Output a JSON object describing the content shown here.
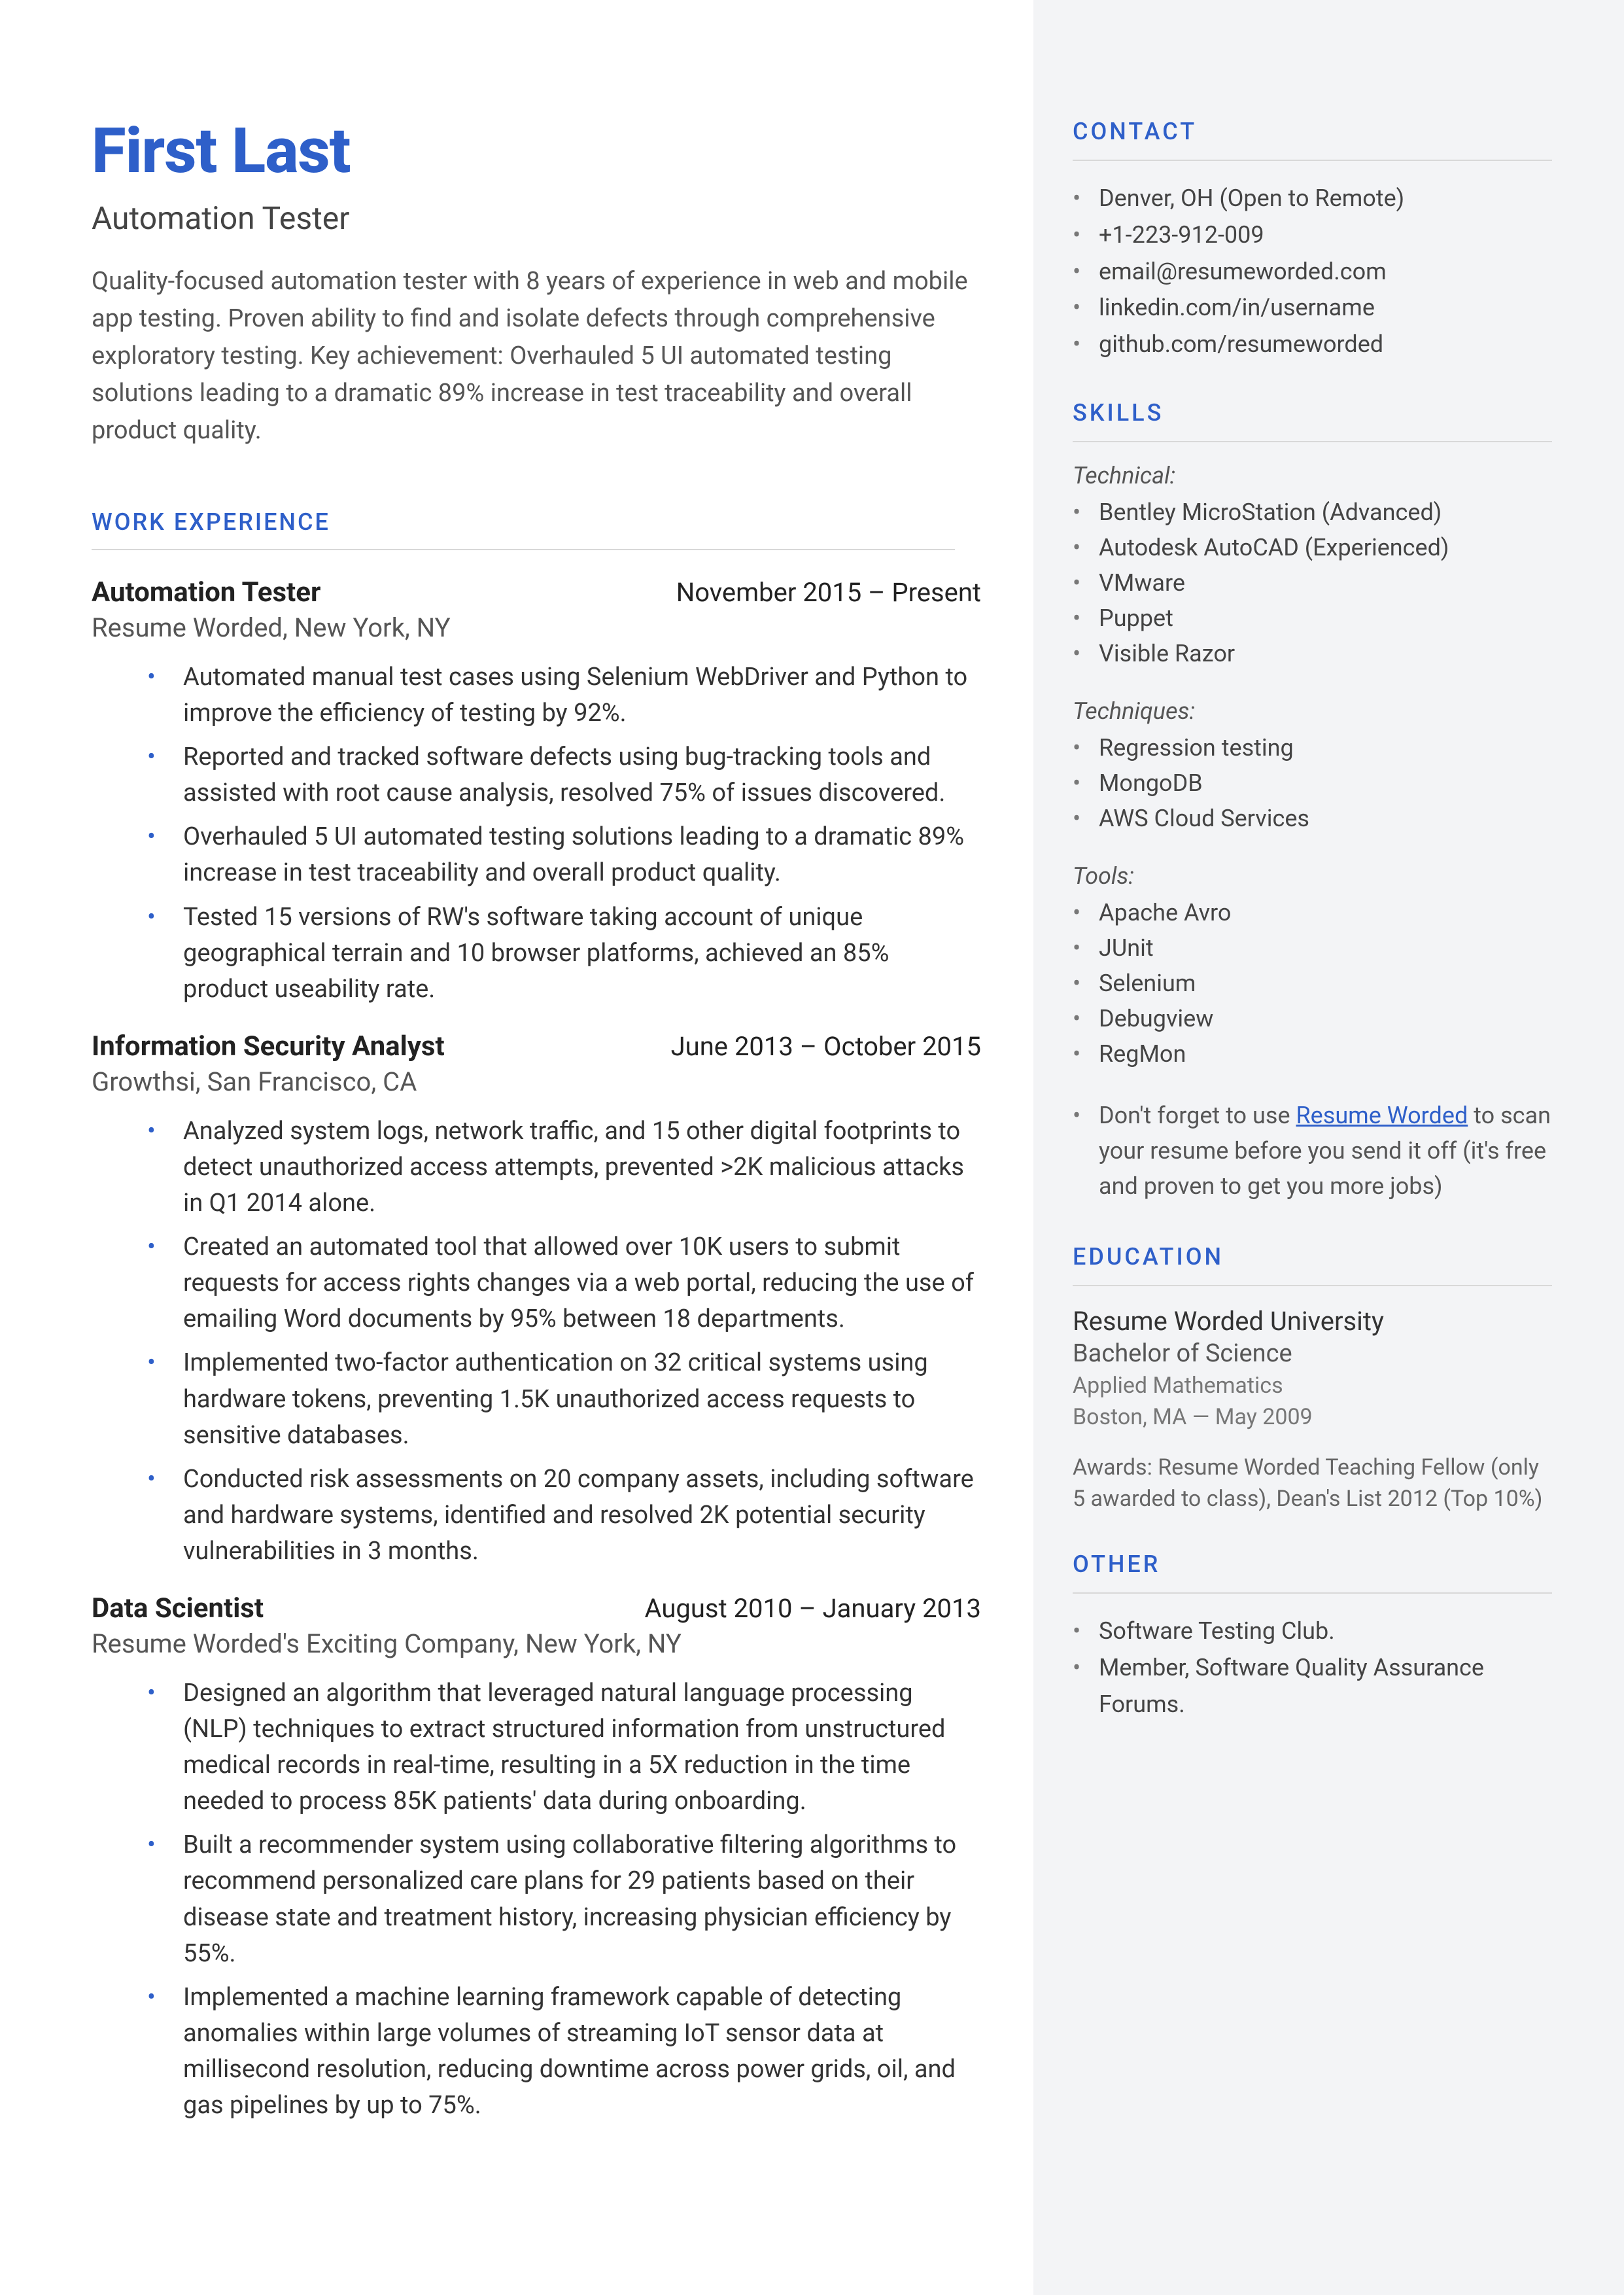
{
  "header": {
    "name": "First Last",
    "title": "Automation Tester",
    "summary": "Quality-focused automation tester with 8 years of experience in web and mobile app testing. Proven ability to find and isolate defects through comprehensive exploratory testing. Key achievement: Overhauled 5 UI automated testing solutions leading to a dramatic 89% increase in test traceability and overall product quality."
  },
  "sections": {
    "work": "WORK EXPERIENCE",
    "contact": "CONTACT",
    "skills": "SKILLS",
    "education": "EDUCATION",
    "other": "OTHER"
  },
  "jobs": [
    {
      "title": "Automation Tester",
      "dates": "November 2015 – Present",
      "loc": "Resume Worded, New York, NY",
      "bullets": [
        "Automated manual test cases using Selenium WebDriver and Python to improve the efficiency of testing by 92%.",
        "Reported and tracked software defects using bug-tracking tools and assisted with root cause analysis, resolved 75% of issues discovered.",
        "Overhauled 5 UI automated testing solutions leading to a  dramatic 89% increase in test traceability and overall product quality.",
        "Tested 15 versions of RW's software taking account of unique geographical terrain and 10 browser platforms, achieved an 85% product useability rate."
      ]
    },
    {
      "title": "Information Security Analyst",
      "dates": "June 2013 – October 2015",
      "loc": "Growthsi, San Francisco, CA",
      "bullets": [
        "Analyzed system logs, network traffic, and 15 other digital footprints to detect unauthorized access attempts, prevented >2K malicious attacks in Q1 2014 alone.",
        "Created an automated tool that allowed over 10K users to submit requests for access rights changes via a web portal, reducing the use of emailing Word documents by 95% between 18 departments.",
        "Implemented two-factor authentication on 32 critical systems using hardware tokens, preventing 1.5K unauthorized access requests to sensitive databases.",
        "Conducted risk assessments on 20 company assets, including software and hardware systems, identified and resolved 2K potential security vulnerabilities in 3 months."
      ]
    },
    {
      "title": "Data Scientist",
      "dates": "August 2010 – January 2013",
      "loc": "Resume Worded's Exciting Company, New York, NY",
      "bullets": [
        "Designed an algorithm that leveraged natural language processing (NLP) techniques to extract structured information from unstructured medical records in real-time, resulting in a 5X reduction in the time needed to process 85K patients' data during onboarding.",
        "Built a recommender system using collaborative filtering algorithms to recommend personalized care plans for 29 patients based on their disease state and treatment history, increasing physician efficiency by 55%.",
        "Implemented a machine learning framework capable of detecting anomalies within large volumes of streaming IoT sensor data at millisecond resolution, reducing downtime across power grids, oil, and gas pipelines by up to 75%."
      ]
    }
  ],
  "contact": [
    "Denver, OH (Open to Remote)",
    "+1-223-912-009",
    "email@resumeworded.com",
    "linkedin.com/in/username",
    "github.com/resumeworded"
  ],
  "skills": {
    "groups": [
      {
        "h": "Technical:",
        "items": [
          "Bentley MicroStation (Advanced)",
          "Autodesk AutoCAD (Experienced)",
          "VMware",
          "Puppet",
          "Visible Razor"
        ]
      },
      {
        "h": "Techniques:",
        "items": [
          "Regression testing",
          "MongoDB",
          "AWS Cloud Services"
        ]
      },
      {
        "h": "Tools:",
        "items": [
          "Apache Avro",
          "JUnit",
          "Selenium",
          "Debugview",
          "RegMon"
        ]
      }
    ],
    "tip_pre": "Don't forget to use ",
    "tip_link": "Resume Worded",
    "tip_post": " to scan your resume before you send it off (it's free and proven to get you more jobs)"
  },
  "education": {
    "school": "Resume Worded University",
    "degree": "Bachelor of Science",
    "field": "Applied Mathematics",
    "loc": "Boston, MA — May 2009",
    "awards": "Awards: Resume Worded Teaching Fellow (only 5 awarded to class), Dean's List 2012 (Top 10%)"
  },
  "other": [
    "Software Testing Club.",
    "Member, Software Quality Assurance Forums."
  ]
}
